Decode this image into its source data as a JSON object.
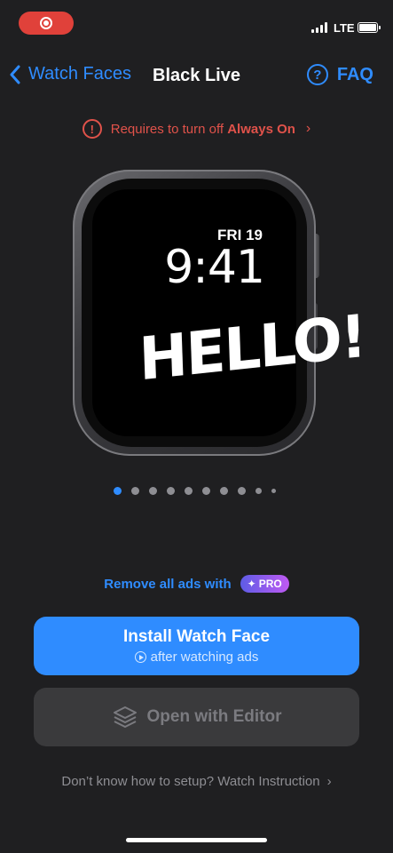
{
  "status_bar": {
    "network": "LTE"
  },
  "nav": {
    "back_label": "Watch Faces",
    "title": "Black Live",
    "faq_label": "FAQ",
    "faq_icon_text": "?"
  },
  "warning": {
    "icon_text": "!",
    "text": "Requires to turn off",
    "emphasis": "Always On",
    "chevron": "›"
  },
  "watch": {
    "date": "FRI 19",
    "time": "9:41",
    "face_text": "HELLO!"
  },
  "pager": {
    "total": 10,
    "active_index": 0
  },
  "promo": {
    "text": "Remove all ads with",
    "badge": "PRO",
    "badge_icon": "✦"
  },
  "install": {
    "title": "Install Watch Face",
    "subtitle": "after watching ads"
  },
  "editor": {
    "label": "Open with Editor"
  },
  "help": {
    "text": "Don’t know how to setup? Watch Instruction",
    "chevron": "›"
  },
  "colors": {
    "accent": "#2f8cff",
    "warning": "#e0524a",
    "background": "#1f1f21",
    "record": "#e0413a"
  }
}
